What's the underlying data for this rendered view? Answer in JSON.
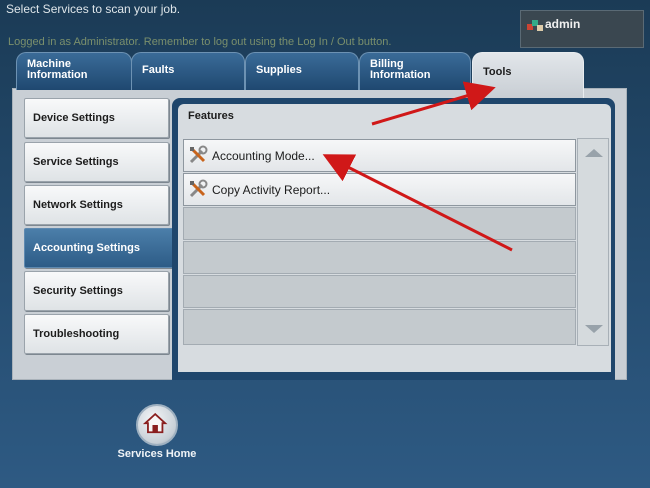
{
  "header": {
    "instruction": "Select Services to scan your job.",
    "login_message": "Logged in as Administrator. Remember to log out using the Log In / Out button.",
    "user": "admin"
  },
  "tabs": [
    {
      "label": "Machine\nInformation",
      "active": false
    },
    {
      "label": "Faults",
      "active": false
    },
    {
      "label": "Supplies",
      "active": false
    },
    {
      "label": "Billing\nInformation",
      "active": false
    },
    {
      "label": "Tools",
      "active": true
    }
  ],
  "sidebar": {
    "items": [
      {
        "label": "Device Settings",
        "active": false
      },
      {
        "label": "Service Settings",
        "active": false
      },
      {
        "label": "Network Settings",
        "active": false
      },
      {
        "label": "Accounting Settings",
        "active": true
      },
      {
        "label": "Security Settings",
        "active": false
      },
      {
        "label": "Troubleshooting",
        "active": false
      }
    ]
  },
  "features": {
    "title": "Features",
    "items": [
      {
        "label": "Accounting Mode...",
        "icon": "tools-icon"
      },
      {
        "label": "Copy Activity Report...",
        "icon": "tools-icon"
      }
    ]
  },
  "footer": {
    "services_home": "Services Home"
  },
  "colors": {
    "annotation_arrow": "#d01818",
    "active_tab": "#d6dbe0",
    "active_sidebar": "#3a6a96"
  }
}
